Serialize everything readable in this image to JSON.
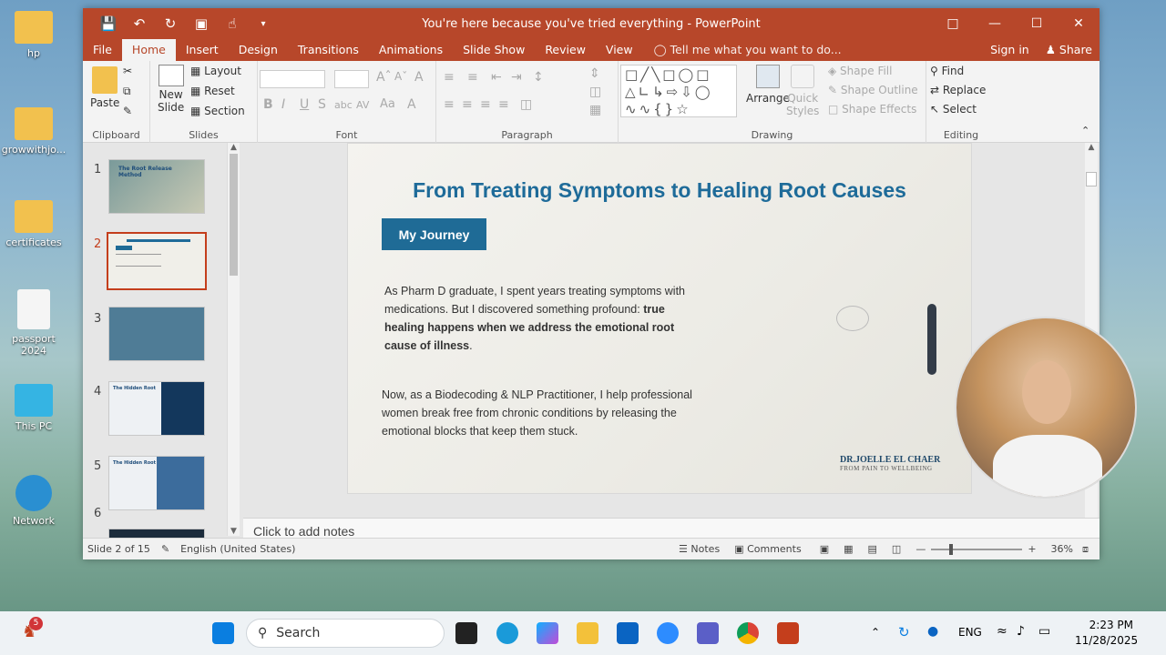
{
  "desktop": {
    "icons": [
      {
        "label": "hp"
      },
      {
        "label": "growwithjo..."
      },
      {
        "label": "certificates"
      },
      {
        "label": "passport 2024"
      },
      {
        "label": "This PC"
      },
      {
        "label": "Network"
      }
    ]
  },
  "window": {
    "title": "You're here because you've tried everything - PowerPoint",
    "tabs": [
      "File",
      "Home",
      "Insert",
      "Design",
      "Transitions",
      "Animations",
      "Slide Show",
      "Review",
      "View"
    ],
    "tell_me": "Tell me what you want to do...",
    "sign_in": "Sign in",
    "share": "Share"
  },
  "ribbon": {
    "clipboard": {
      "paste": "Paste",
      "label": "Clipboard"
    },
    "slides": {
      "new_slide_line1": "New",
      "new_slide_line2": "Slide",
      "layout": "Layout",
      "reset": "Reset",
      "section": "Section",
      "label": "Slides"
    },
    "font": {
      "label": "Font"
    },
    "paragraph": {
      "label": "Paragraph"
    },
    "drawing": {
      "arrange": "Arrange",
      "quick_styles_line1": "Quick",
      "quick_styles_line2": "Styles",
      "shape_fill": "Shape Fill",
      "shape_outline": "Shape Outline",
      "shape_effects": "Shape Effects",
      "label": "Drawing"
    },
    "editing": {
      "find": "Find",
      "replace": "Replace",
      "select": "Select",
      "label": "Editing"
    }
  },
  "thumbnails": [
    {
      "num": "1",
      "caption": "The Root Release Method"
    },
    {
      "num": "2"
    },
    {
      "num": "3"
    },
    {
      "num": "4",
      "caption": "The Hidden Root"
    },
    {
      "num": "5",
      "caption": "The Hidden Root"
    },
    {
      "num": "6"
    }
  ],
  "slide": {
    "title": "From Treating Symptoms to Healing Root Causes",
    "badge": "My Journey",
    "para1_normal": "As Pharm D graduate, I spent years treating symptoms with medications. But I discovered something profound: ",
    "para1_bold": "true healing happens when we address the emotional root cause of illness",
    "para1_end": ".",
    "para2": "Now, as a Biodecoding & NLP Practitioner, I help professional women break free from chronic conditions by releasing the emotional blocks that keep them stuck.",
    "logo_name": "DR.JOELLE EL CHAER",
    "logo_tag": "FROM PAIN TO WELLBEING"
  },
  "notes_placeholder": "Click to add notes",
  "status": {
    "slide_count": "Slide 2 of 15",
    "language": "English (United States)",
    "notes": "Notes",
    "comments": "Comments",
    "zoom": "36%"
  },
  "taskbar": {
    "search": "Search",
    "badge": "5",
    "lang": "ENG",
    "time": "2:23 PM",
    "date": "11/28/2025"
  },
  "colors": {
    "accent": "#b7472a",
    "slide_title": "#1e6b99",
    "badge_bg": "#1f6b96"
  }
}
